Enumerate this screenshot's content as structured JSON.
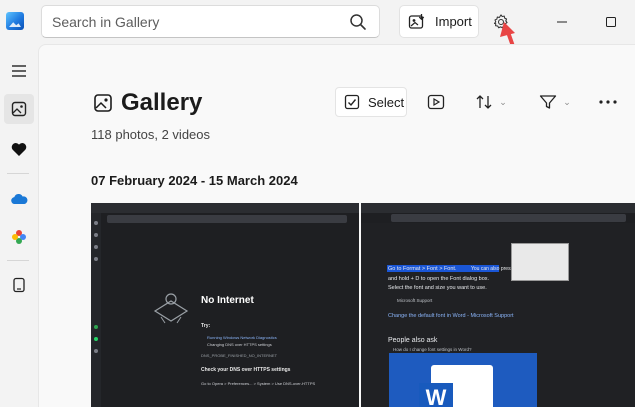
{
  "titlebar": {
    "search_placeholder": "Search in Gallery",
    "import_label": "Import",
    "icons": [
      "search-icon",
      "import-icon",
      "gear-icon",
      "minimize-icon",
      "maximize-icon"
    ]
  },
  "sidebar": {
    "items": [
      "menu-icon",
      "gallery-icon",
      "favorites-heart-icon",
      "onedrive-cloud-icon",
      "photos-pinwheel-icon",
      "import-device-icon"
    ]
  },
  "main": {
    "title": "Gallery",
    "subtitle": "118 photos, 2 videos",
    "select_label": "Select",
    "date_range": "07 February 2024 - 15 March 2024"
  },
  "thumbnails": [
    {
      "kind": "browser-screenshot",
      "heading": "No Internet",
      "lines": [
        "Try:",
        "Running Windows Network Diagnostics",
        "Changing DNS over HTTPS settings",
        "DNS_PROBE_FINISHED_NO_INTERNET",
        "Check your DNS over HTTPS settings",
        "Go to Opera > Preferences... > System > Use DNS-over-HTTPS"
      ]
    },
    {
      "kind": "search-results-screenshot",
      "highlight": "Go to Format > Font > Font.",
      "text1": "You can also press",
      "text2": "and hold + D to open the Font dialog box.",
      "text3": "Select the font and size you want to use.",
      "source": "Microsoft Support",
      "link": "Change the default font in Word - Microsoft Support",
      "paa": "People also ask",
      "question": "How do I change font settings in Word?"
    }
  ],
  "colors": {
    "accent": "#e84545",
    "word_blue": "#185abd",
    "highlight": "#1a56d6"
  }
}
